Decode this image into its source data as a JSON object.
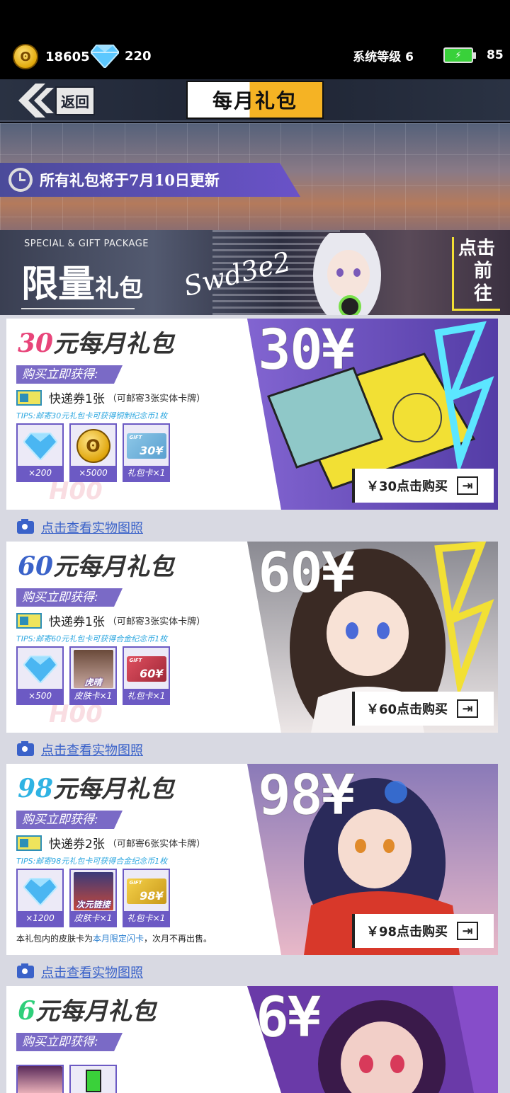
{
  "status": {
    "coins": "18605",
    "gems": "220",
    "system_level": "系统等级 6",
    "battery": "85"
  },
  "nav": {
    "back_label": "返回",
    "title": "每月礼包"
  },
  "banner": {
    "update_text": "所有礼包将于7月10日更新"
  },
  "limited": {
    "subtitle": "SPECIAL & GIFT PACKAGE",
    "title_big": "限量",
    "title_small": "礼包",
    "signature": "Swd3e2",
    "cta_line1": "点击",
    "cta_line2": "前往"
  },
  "packages": [
    {
      "price_num": "30",
      "title_suffix": "元每月礼包",
      "price_big": "30¥",
      "get_label": "购买立即获得:",
      "voucher": "快递券1张",
      "voucher_note": "（可邮寄3张实体卡牌）",
      "tips": "TIPS:邮寄30元礼包卡可获得铜制纪念币1枚",
      "items": [
        "×200",
        "×5000",
        "礼包卡×1"
      ],
      "card_value": "30¥",
      "buy_label": "￥30点击购买",
      "accent": "#e8457a"
    },
    {
      "price_num": "60",
      "title_suffix": "元每月礼包",
      "price_big": "60¥",
      "get_label": "购买立即获得:",
      "voucher": "快递券1张",
      "voucher_note": "（可邮寄3张实体卡牌）",
      "tips": "TIPS:邮寄60元礼包卡可获得合金纪念币1枚",
      "items": [
        "×500",
        "皮肤卡×1",
        "礼包卡×1"
      ],
      "skin_name": "虎晴",
      "card_value": "60¥",
      "buy_label": "￥60点击购买",
      "accent": "#3b63c9"
    },
    {
      "price_num": "98",
      "title_suffix": "元每月礼包",
      "price_big": "98¥",
      "get_label": "购买立即获得:",
      "voucher": "快递券2张",
      "voucher_note": "（可邮寄6张实体卡牌）",
      "tips": "TIPS:邮寄98元礼包卡可获得合金纪念币1枚",
      "items": [
        "×1200",
        "皮肤卡×1",
        "礼包卡×1"
      ],
      "skin_name": "次元链接",
      "card_value": "98¥",
      "buy_label": "￥98点击购买",
      "note_prefix": "本礼包内的皮肤卡为",
      "note_highlight": "本月限定闪卡",
      "note_suffix": "，次月不再出售。",
      "accent": "#2fb3e3"
    },
    {
      "price_num": "6",
      "title_suffix": "元每月礼包",
      "price_big": "6¥",
      "get_label": "购买立即获得:",
      "accent": "#2fcf7a"
    }
  ],
  "photo_link": "点击查看实物图照"
}
